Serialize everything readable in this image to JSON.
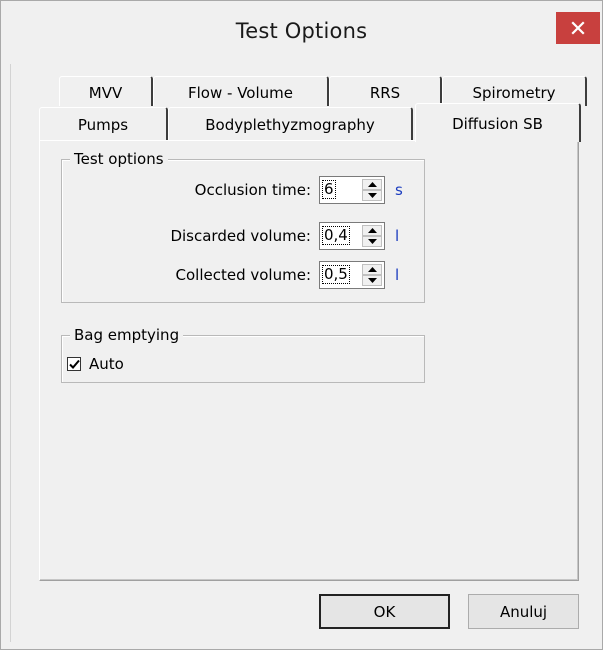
{
  "window": {
    "title": "Test Options"
  },
  "tabs": {
    "row_back": [
      "MVV",
      "Flow - Volume",
      "RRS",
      "Spirometry"
    ],
    "row_front": [
      "Pumps",
      "Bodyplethyzmography",
      "Diffusion SB"
    ],
    "active": "Diffusion SB"
  },
  "test_options": {
    "legend": "Test options",
    "occlusion_time": {
      "label": "Occlusion time:",
      "value": "6",
      "unit": "s"
    },
    "discarded_volume": {
      "label": "Discarded volume:",
      "value": "0,4",
      "unit": "l"
    },
    "collected_volume": {
      "label": "Collected volume:",
      "value": "0,5",
      "unit": "l"
    }
  },
  "bag_emptying": {
    "legend": "Bag emptying",
    "auto": {
      "label": "Auto",
      "checked": true
    }
  },
  "buttons": {
    "ok": "OK",
    "cancel": "Anuluj"
  },
  "colors": {
    "close_button": "#c8403e",
    "unit_text": "#1c3dbf"
  }
}
